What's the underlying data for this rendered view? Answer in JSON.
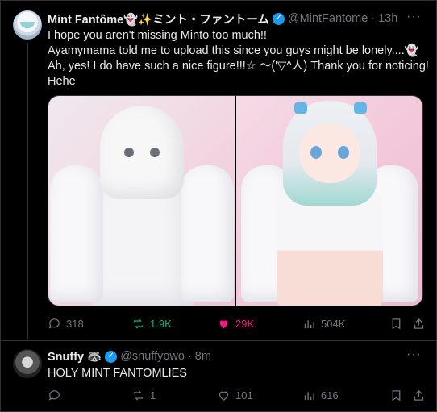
{
  "main_tweet": {
    "display_name": "Mint Fantôme👻✨ミント・ファントーム",
    "handle": "@MintFantome",
    "time": "13h",
    "text_lines": [
      "I hope you aren't missing Minto too much!!",
      "Ayamymama told me to upload this since you guys might be lonely....👻",
      "Ah, yes! I do have such a nice figure!!!☆ 〜('▽^人)   Thank you for noticing!",
      "Hehe"
    ],
    "metrics": {
      "replies": "318",
      "retweets": "1.9K",
      "likes": "29K",
      "views": "504K"
    }
  },
  "reply_tweet": {
    "display_name": "Snuffy 🦝",
    "handle": "@snuffyowo",
    "time": "8m",
    "text": "HOLY MINT FANTOMLIES",
    "metrics": {
      "replies": "",
      "retweets": "1",
      "likes": "101",
      "views": "616"
    }
  },
  "ui": {
    "more_glyph": "···",
    "separator": "·",
    "verified_glyph": "✓"
  },
  "colors": {
    "background": "#000000",
    "text": "#e7e9ea",
    "muted": "#71767b",
    "verified": "#1d9bf0",
    "retweet_active": "#00ba7c",
    "like_active": "#f91880"
  }
}
